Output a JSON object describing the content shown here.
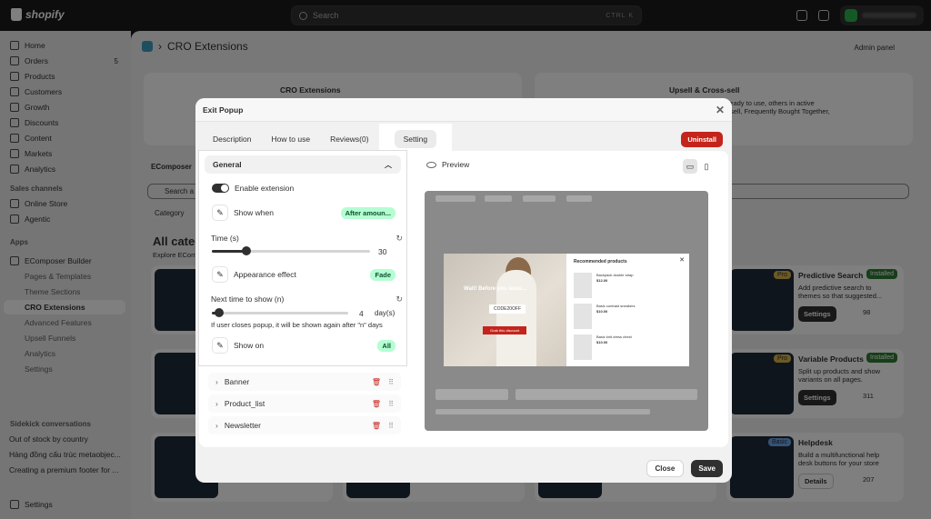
{
  "topbar": {
    "brand": "shopify",
    "search_placeholder": "Search",
    "search_shortcut": "CTRL K",
    "notification_count": "1"
  },
  "sidebar": {
    "items": [
      {
        "label": "Home",
        "icon": "home-icon"
      },
      {
        "label": "Orders",
        "icon": "inbox-icon",
        "badge": "5"
      },
      {
        "label": "Products",
        "icon": "tag-icon"
      },
      {
        "label": "Customers",
        "icon": "person-icon"
      },
      {
        "label": "Growth",
        "icon": "chart-icon"
      },
      {
        "label": "Discounts",
        "icon": "discount-icon"
      },
      {
        "label": "Content",
        "icon": "file-icon"
      },
      {
        "label": "Markets",
        "icon": "globe-icon"
      },
      {
        "label": "Analytics",
        "icon": "bar-chart-icon"
      }
    ],
    "sales_channels": {
      "title": "Sales channels",
      "items": [
        "Online Store",
        "Agentic"
      ]
    },
    "apps": {
      "title": "Apps",
      "app": "EComposer Builder",
      "subitems": [
        "Pages & Templates",
        "Theme Sections",
        "CRO Extensions",
        "Advanced Features",
        "Upsell Funnels",
        "Analytics",
        "Settings"
      ]
    },
    "sidekick": {
      "title": "Sidekick conversations",
      "items": [
        "Out of stock by country",
        "Hàng đồng cấu trúc metaobjec...",
        "Creating a premium footer for ..."
      ]
    },
    "settings": "Settings"
  },
  "main": {
    "title": "CRO Extensions",
    "admin_panel": "Admin panel",
    "banner1_title": "CRO Extensions",
    "banner2_title": "Upsell & Cross-sell",
    "banner2_text": "xtensions — some ready to use, others in active\nes Bundles, Cart Upsell, Frequently Bought Together,",
    "tab_label": "EComposer",
    "search": "Search a",
    "category": "Category",
    "all_heading": "All categ",
    "all_sub": "Explore ECom",
    "apps": [
      {
        "tag": "Pro",
        "title": "Predictive Search",
        "status": "Installed",
        "desc": "Add predictive search to themes so that suggested...",
        "action": "Settings",
        "count": "98"
      },
      {
        "tag": "Pro",
        "title": "Variable Products",
        "status": "Installed",
        "desc": "Split up products and show variants on all pages.",
        "action": "Settings",
        "count": "311"
      },
      {
        "tag": "Basic",
        "title": "Helpdesk",
        "status": "",
        "desc": "Build a multifunctional help desk buttons for your store",
        "action": "Details",
        "count": "207"
      }
    ]
  },
  "modal": {
    "title": "Exit Popup",
    "tabs": [
      "Description",
      "How to use",
      "Reviews(0)",
      "Setting"
    ],
    "uninstall": "Uninstall",
    "general": "General",
    "enable_extension": "Enable extension",
    "show_when": "Show when",
    "show_when_value": "After amoun...",
    "time_label": "Time (s)",
    "time_value": "30",
    "time_fraction": 0.22,
    "appearance": "Appearance effect",
    "appearance_value": "Fade",
    "next_time_label": "Next time to show (n)",
    "next_time_value": "4",
    "next_time_unit": "day(s)",
    "next_time_fraction": 0.05,
    "hint": "If user closes popup, it will be shown again after \"n\" days",
    "show_on": "Show on",
    "show_on_value": "All",
    "sections": [
      "Banner",
      "Product_list",
      "Newsletter"
    ],
    "preview": "Preview",
    "popup": {
      "headline": "Wait! Before you leave...",
      "code": "CODE20OFF",
      "button": "Grab this discount",
      "rec_title": "Recommended products",
      "products": [
        {
          "name": "Backpack double strap",
          "price": "$12.00"
        },
        {
          "name": "Basic contrast sneakers",
          "price": "$10.00"
        },
        {
          "name": "Basic knit dress chest",
          "price": "$10.00"
        }
      ]
    },
    "close": "Close",
    "save": "Save"
  }
}
